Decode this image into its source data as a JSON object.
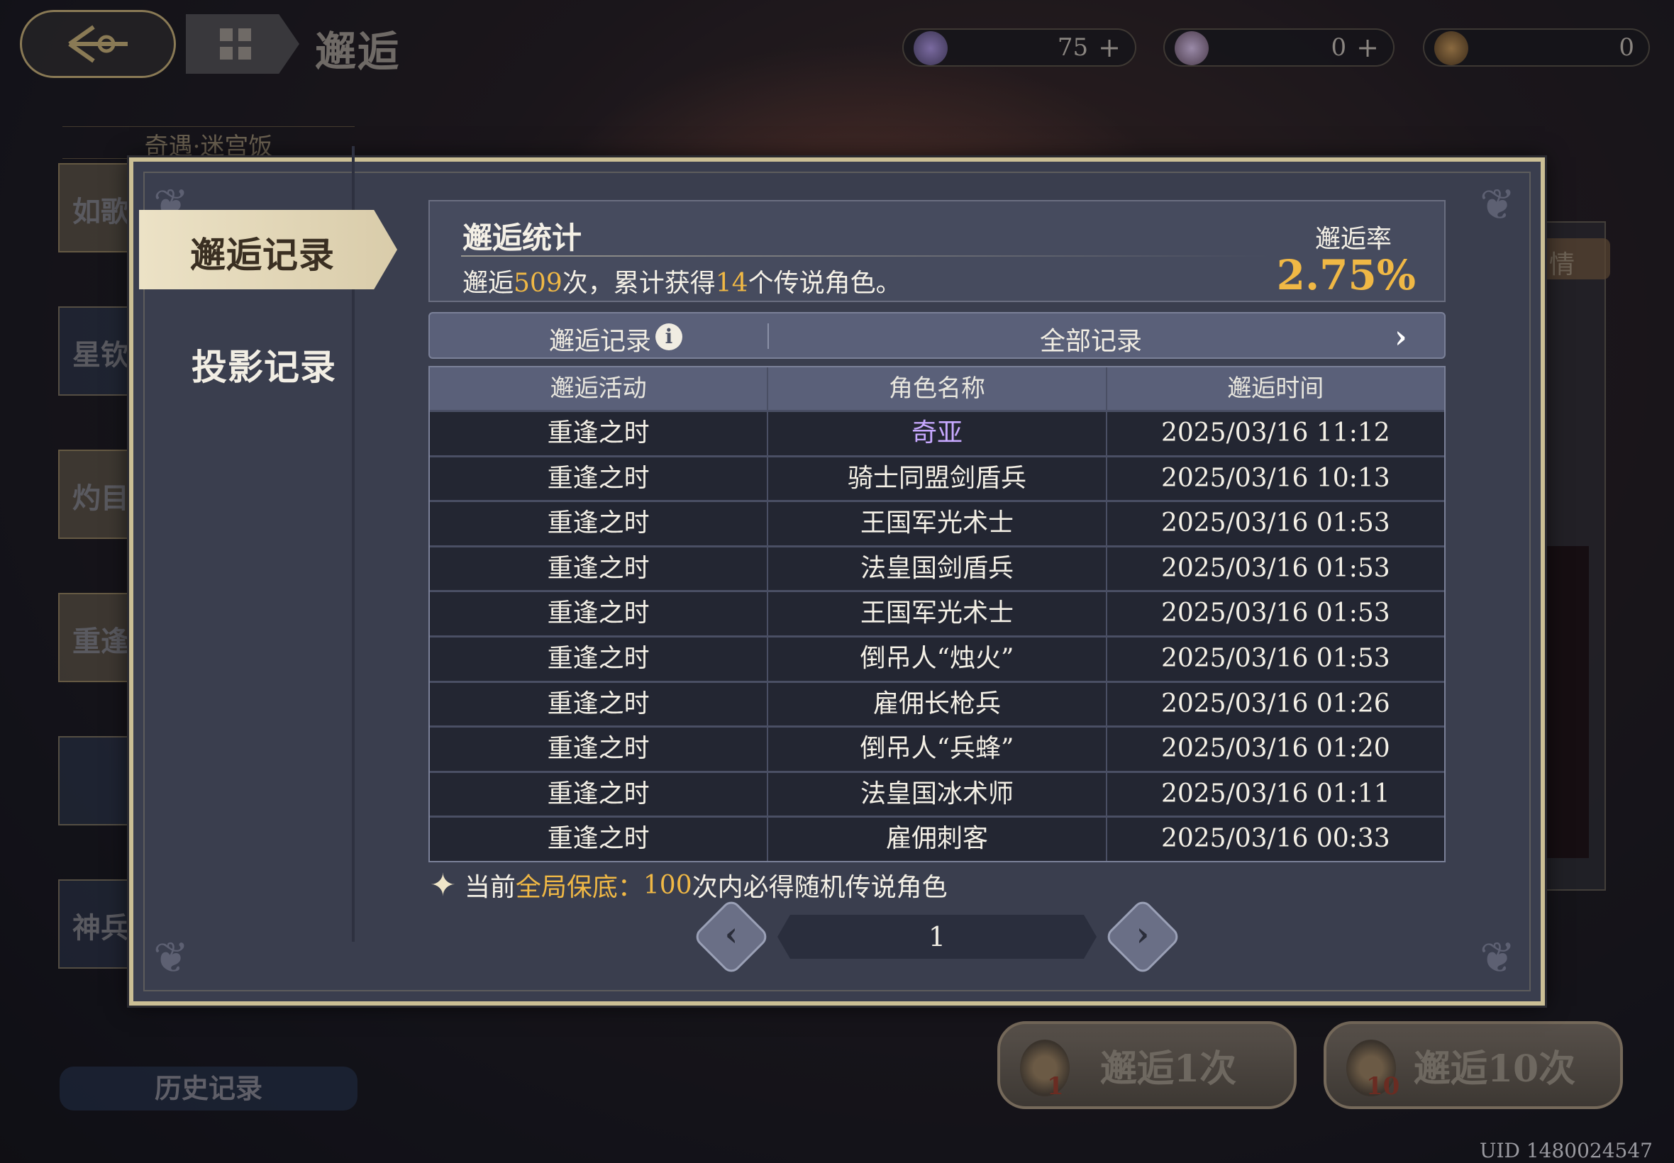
{
  "header": {
    "title": "邂逅"
  },
  "currencies": [
    {
      "icon": "star-gem-icon",
      "value": "75",
      "has_plus": true
    },
    {
      "icon": "feather-orb-icon",
      "value": "0",
      "has_plus": true
    },
    {
      "icon": "lion-medal-icon",
      "value": "0",
      "has_plus": false
    }
  ],
  "background": {
    "left_header": "奇遇·迷宫饭",
    "left_cards": [
      "如歌",
      "星钦",
      "灼目",
      "重逢",
      "",
      "神兵"
    ],
    "history_button": "历史记录",
    "right_tag": "情",
    "pull_one": "邂逅1次",
    "pull_one_num": "1",
    "pull_ten": "邂逅10次",
    "pull_ten_num": "10",
    "uid": "UID 1480024547"
  },
  "modal": {
    "tabs": {
      "active": "邂逅记录",
      "inactive": "投影记录"
    },
    "stats": {
      "title": "邂逅统计",
      "desc_prefix": "邂逅",
      "pull_count": "509",
      "desc_mid": "次，累计获得",
      "legend_count": "14",
      "desc_suffix": "个传说角色。",
      "rate_label": "邂逅率",
      "rate_value": "2.75%"
    },
    "record_bar": {
      "label": "邂逅记录",
      "filter": "全部记录"
    },
    "table": {
      "headers": [
        "邂逅活动",
        "角色名称",
        "邂逅时间"
      ],
      "rows": [
        {
          "event": "重逢之时",
          "name": "奇亚",
          "time": "2025/03/16 11:12",
          "rare": true
        },
        {
          "event": "重逢之时",
          "name": "骑士同盟剑盾兵",
          "time": "2025/03/16 10:13",
          "rare": false
        },
        {
          "event": "重逢之时",
          "name": "王国军光术士",
          "time": "2025/03/16 01:53",
          "rare": false
        },
        {
          "event": "重逢之时",
          "name": "法皇国剑盾兵",
          "time": "2025/03/16 01:53",
          "rare": false
        },
        {
          "event": "重逢之时",
          "name": "王国军光术士",
          "time": "2025/03/16 01:53",
          "rare": false
        },
        {
          "event": "重逢之时",
          "name": "倒吊人“烛火”",
          "time": "2025/03/16 01:53",
          "rare": false
        },
        {
          "event": "重逢之时",
          "name": "雇佣长枪兵",
          "time": "2025/03/16 01:26",
          "rare": false
        },
        {
          "event": "重逢之时",
          "name": "倒吊人“兵蜂”",
          "time": "2025/03/16 01:20",
          "rare": false
        },
        {
          "event": "重逢之时",
          "name": "法皇国冰术师",
          "time": "2025/03/16 01:11",
          "rare": false
        },
        {
          "event": "重逢之时",
          "name": "雇佣刺客",
          "time": "2025/03/16 00:33",
          "rare": false
        }
      ]
    },
    "guarantee": {
      "prefix": "当前",
      "highlight": "全局保底：",
      "count": "100",
      "suffix": "次内必得随机传说角色"
    },
    "pager": {
      "page": "1"
    }
  },
  "colors": {
    "highlight": "#f0b845",
    "rare_name": "#c7a8ff",
    "modal_border": "#cbbf95",
    "modal_bg": "#3a3e4e"
  }
}
